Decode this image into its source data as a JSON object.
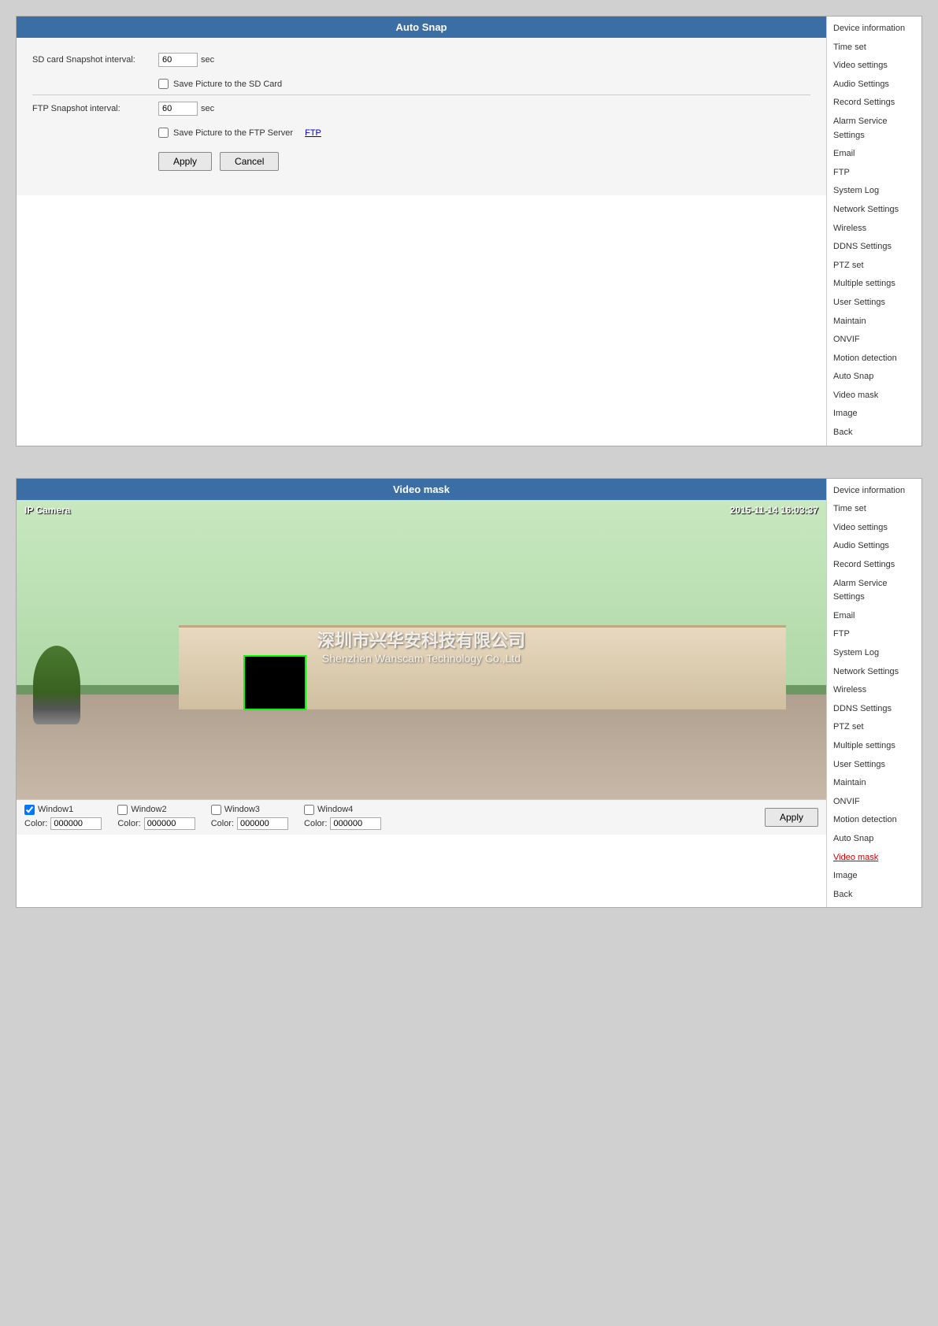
{
  "panel1": {
    "header": "Auto Snap",
    "sdcard_label": "SD card Snapshot interval:",
    "sdcard_value": "60",
    "sdcard_unit": "sec",
    "sdcard_checkbox_label": "Save Picture to the SD Card",
    "ftp_label": "FTP Snapshot interval:",
    "ftp_value": "60",
    "ftp_unit": "sec",
    "ftp_checkbox_label": "Save Picture to the FTP Server",
    "ftp_link_label": "FTP",
    "apply_btn": "Apply",
    "cancel_btn": "Cancel"
  },
  "panel2": {
    "header": "Video mask",
    "cam_label": "IP Camera",
    "cam_timestamp": "2015-11-14 16:03:37",
    "cam_watermark_cn": "深圳市兴华安科技有限公司",
    "cam_watermark_en": "Shenzhen Wanscam Technology Co.,Ltd",
    "windows": [
      {
        "label": "Window1",
        "checked": true,
        "color": "000000"
      },
      {
        "label": "Window2",
        "checked": false,
        "color": "000000"
      },
      {
        "label": "Window3",
        "checked": false,
        "color": "000000"
      },
      {
        "label": "Window4",
        "checked": false,
        "color": "000000"
      }
    ],
    "apply_btn": "Apply"
  },
  "sidebar1": {
    "items": [
      {
        "label": "Device information",
        "active": false,
        "bold": false
      },
      {
        "label": "Time set",
        "active": false,
        "bold": false
      },
      {
        "label": "Video settings",
        "active": false,
        "bold": false
      },
      {
        "label": "Audio Settings",
        "active": false,
        "bold": false
      },
      {
        "label": "Record Settings",
        "active": false,
        "bold": false
      },
      {
        "label": "Alarm Service Settings",
        "active": false,
        "bold": false
      },
      {
        "label": "Email",
        "active": false,
        "bold": false
      },
      {
        "label": "FTP",
        "active": false,
        "bold": false
      },
      {
        "label": "System Log",
        "active": false,
        "bold": false
      },
      {
        "label": "Network Settings",
        "active": false,
        "bold": false
      },
      {
        "label": "Wireless",
        "active": false,
        "bold": false
      },
      {
        "label": "DDNS Settings",
        "active": false,
        "bold": false
      },
      {
        "label": "PTZ set",
        "active": false,
        "bold": false
      },
      {
        "label": "Multiple settings",
        "active": false,
        "bold": false
      },
      {
        "label": "User Settings",
        "active": false,
        "bold": false
      },
      {
        "label": "Maintain",
        "active": false,
        "bold": false
      },
      {
        "label": "ONVIF",
        "active": false,
        "bold": false
      },
      {
        "label": "Motion detection",
        "active": false,
        "bold": false
      },
      {
        "label": "Auto Snap",
        "active": false,
        "bold": false
      },
      {
        "label": "Video mask",
        "active": false,
        "bold": false
      },
      {
        "label": "Image",
        "active": false,
        "bold": false
      },
      {
        "label": "Back",
        "active": false,
        "bold": false
      }
    ]
  },
  "sidebar2": {
    "items": [
      {
        "label": "Device information",
        "active": false
      },
      {
        "label": "Time set",
        "active": false
      },
      {
        "label": "Video settings",
        "active": false
      },
      {
        "label": "Audio Settings",
        "active": false
      },
      {
        "label": "Record Settings",
        "active": false
      },
      {
        "label": "Alarm Service Settings",
        "active": false
      },
      {
        "label": "Email",
        "active": false
      },
      {
        "label": "FTP",
        "active": false
      },
      {
        "label": "System Log",
        "active": false
      },
      {
        "label": "Network Settings",
        "active": false
      },
      {
        "label": "Wireless",
        "active": false
      },
      {
        "label": "DDNS Settings",
        "active": false
      },
      {
        "label": "PTZ set",
        "active": false
      },
      {
        "label": "Multiple settings",
        "active": false
      },
      {
        "label": "User Settings",
        "active": false
      },
      {
        "label": "Maintain",
        "active": false
      },
      {
        "label": "ONVIF",
        "active": false
      },
      {
        "label": "Motion detection",
        "active": false
      },
      {
        "label": "Auto Snap",
        "active": false
      },
      {
        "label": "Video mask",
        "active": true
      },
      {
        "label": "Image",
        "active": false
      },
      {
        "label": "Back",
        "active": false
      }
    ]
  }
}
